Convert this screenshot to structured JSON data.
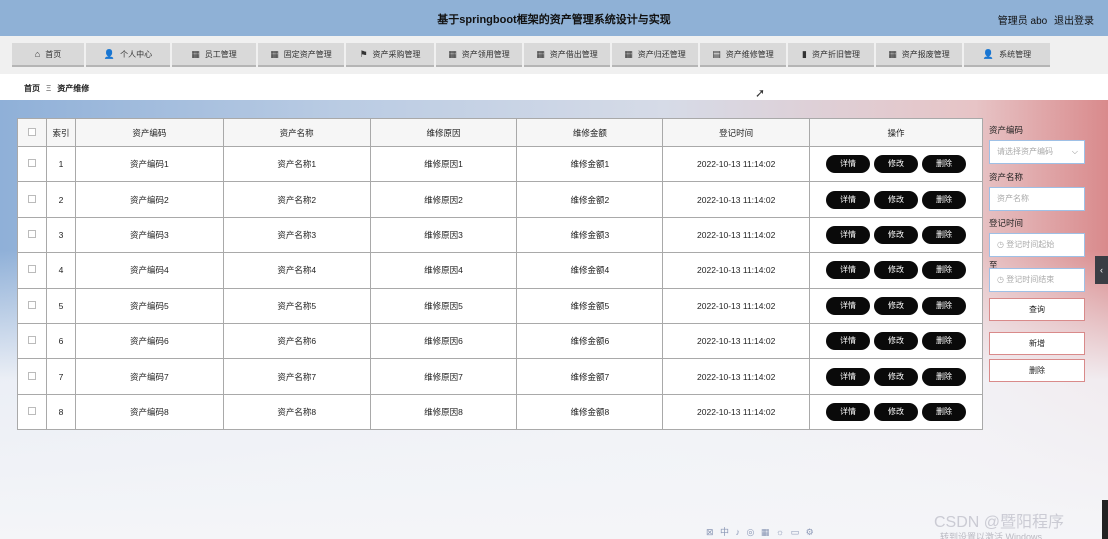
{
  "app": {
    "title": "基于springboot框架的资产管理系统设计与实现",
    "user_label": "管理员 abo",
    "logout_label": "退出登录"
  },
  "nav": {
    "items": [
      {
        "label": "首页",
        "icon": "home-icon"
      },
      {
        "label": "个人中心",
        "icon": "user-icon"
      },
      {
        "label": "员工管理",
        "icon": "grid-icon"
      },
      {
        "label": "固定资产管理",
        "icon": "grid-icon"
      },
      {
        "label": "资产采购管理",
        "icon": "flag-icon"
      },
      {
        "label": "资产领用管理",
        "icon": "grid-icon"
      },
      {
        "label": "资产借出管理",
        "icon": "grid-icon"
      },
      {
        "label": "资产归还管理",
        "icon": "grid-icon"
      },
      {
        "label": "资产维修管理",
        "icon": "clipboard-icon"
      },
      {
        "label": "资产折旧管理",
        "icon": "bar-chart-icon"
      },
      {
        "label": "资产报废管理",
        "icon": "grid-icon"
      },
      {
        "label": "系统管理",
        "icon": "user-icon"
      }
    ]
  },
  "breadcrumb": {
    "home": "首页",
    "separator": "Ξ",
    "current": "资产维修"
  },
  "table": {
    "headers": [
      "索引",
      "资产编码",
      "资产名称",
      "维修原因",
      "维修金额",
      "登记时间",
      "操作"
    ],
    "rows": [
      {
        "index": "1",
        "code": "资产编码1",
        "name": "资产名称1",
        "reason": "维修原因1",
        "amount": "维修金额1",
        "time": "2022-10-13 11:14:02"
      },
      {
        "index": "2",
        "code": "资产编码2",
        "name": "资产名称2",
        "reason": "维修原因2",
        "amount": "维修金额2",
        "time": "2022-10-13 11:14:02"
      },
      {
        "index": "3",
        "code": "资产编码3",
        "name": "资产名称3",
        "reason": "维修原因3",
        "amount": "维修金额3",
        "time": "2022-10-13 11:14:02"
      },
      {
        "index": "4",
        "code": "资产编码4",
        "name": "资产名称4",
        "reason": "维修原因4",
        "amount": "维修金额4",
        "time": "2022-10-13 11:14:02"
      },
      {
        "index": "5",
        "code": "资产编码5",
        "name": "资产名称5",
        "reason": "维修原因5",
        "amount": "维修金额5",
        "time": "2022-10-13 11:14:02"
      },
      {
        "index": "6",
        "code": "资产编码6",
        "name": "资产名称6",
        "reason": "维修原因6",
        "amount": "维修金额6",
        "time": "2022-10-13 11:14:02"
      },
      {
        "index": "7",
        "code": "资产编码7",
        "name": "资产名称7",
        "reason": "维修原因7",
        "amount": "维修金额7",
        "time": "2022-10-13 11:14:02"
      },
      {
        "index": "8",
        "code": "资产编码8",
        "name": "资产名称8",
        "reason": "维修原因8",
        "amount": "维修金额8",
        "time": "2022-10-13 11:14:02"
      }
    ],
    "actions": {
      "detail": "详情",
      "edit": "修改",
      "delete": "删除"
    }
  },
  "search": {
    "code_label": "资产编码",
    "code_placeholder": "请选择资产编码",
    "name_label": "资产名称",
    "name_placeholder": "资产名称",
    "time_label": "登记时间",
    "time_start_placeholder": "登记时间起始",
    "to_label": "至",
    "time_end_placeholder": "登记时间结束",
    "query_button": "查询",
    "add_button": "新增",
    "delete_button": "删除"
  },
  "watermark": {
    "text": "CSDN @暨阳程序",
    "activate_text": "转到设置以激活 Windows"
  }
}
